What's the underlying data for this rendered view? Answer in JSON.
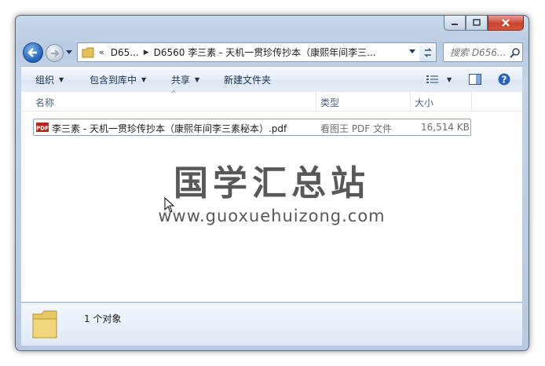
{
  "address": {
    "crumb_1": "D65...",
    "crumb_2": "D6560 李三素 - 天机一贯珍传抄本（康熙年间李三...",
    "overflow_marker": "«"
  },
  "search": {
    "placeholder": "搜索 D656..."
  },
  "toolbar": {
    "organize": "组织",
    "include_in_library": "包含到库中",
    "share": "共享",
    "new_folder": "新建文件夹"
  },
  "columns": {
    "name": "名称",
    "type": "类型",
    "size": "大小"
  },
  "files": [
    {
      "name": "李三素 - 天机一贯珍传抄本（康熙年间李三素秘本）.pdf",
      "type": "看图王 PDF 文件",
      "size": "16,514 KB"
    }
  ],
  "watermark": {
    "title": "国学汇总站",
    "url": "www.guoxuehuizong.com"
  },
  "details": {
    "count": "1 个对象"
  },
  "colors": {
    "window_frame": "#c3d4e9",
    "close_button": "#c8412c",
    "header_text": "#4d6185"
  }
}
